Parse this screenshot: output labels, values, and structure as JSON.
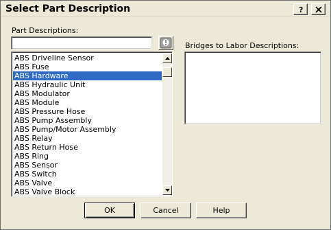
{
  "window": {
    "title": "Select Part Description",
    "help_glyph": "?",
    "close_glyph": "✕"
  },
  "part_descriptions": {
    "label": "Part Descriptions:",
    "search_value": "",
    "search_placeholder": "",
    "warn_icon": "exclamation-icon",
    "items": [
      "ABS Driveline Sensor",
      "ABS Fuse",
      "ABS Hardware",
      "ABS Hydraulic Unit",
      "ABS Modulator",
      "ABS Module",
      "ABS Pressure Hose",
      "ABS Pump Assembly",
      "ABS Pump/Motor Assembly",
      "ABS Relay",
      "ABS Return Hose",
      "ABS Ring",
      "ABS Sensor",
      "ABS Switch",
      "ABS Valve",
      "ABS Valve Block"
    ],
    "selected_item": "ABS Hardware"
  },
  "bridges": {
    "label": "Bridges to Labor Descriptions:"
  },
  "buttons": {
    "ok": "OK",
    "cancel": "Cancel",
    "help": "Help"
  },
  "colors": {
    "dialog_bg": "#ece9d8",
    "selection_bg": "#316ac5",
    "selection_fg": "#ffffff"
  }
}
